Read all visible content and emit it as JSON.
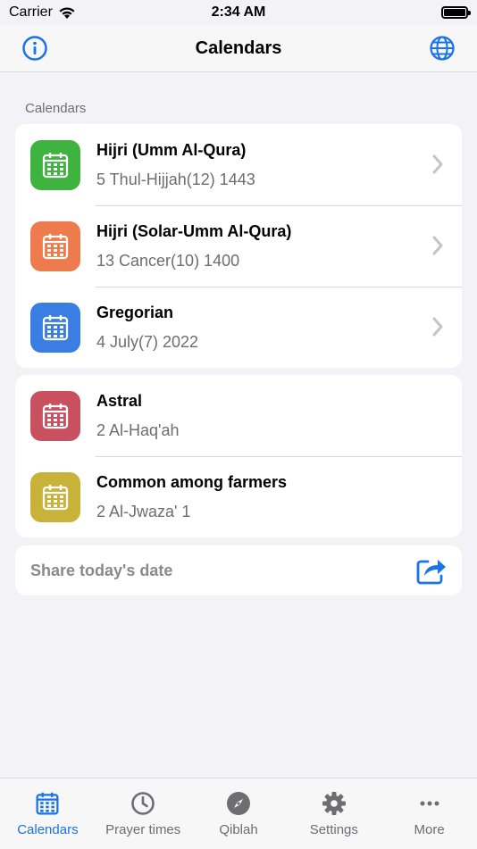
{
  "status": {
    "carrier": "Carrier",
    "time": "2:34 AM"
  },
  "nav": {
    "title": "Calendars",
    "left_icon": "info-icon",
    "right_icon": "globe-icon"
  },
  "section_header": "Calendars",
  "calendars": [
    {
      "title": "Hijri (Umm Al-Qura)",
      "date": "5 Thul-Hijjah(12) 1443",
      "color": "#3eb33f"
    },
    {
      "title": "Hijri (Solar-Umm Al-Qura)",
      "date": "13 Cancer(10) 1400",
      "color": "#ee7b4e"
    },
    {
      "title": "Gregorian",
      "date": "4 July(7) 2022",
      "color": "#3a7ee4"
    }
  ],
  "other_calendars": [
    {
      "title": "Astral",
      "date": "2 Al-Haq'ah",
      "color": "#c9515f"
    },
    {
      "title": "Common among farmers",
      "date": "2 Al-Jwaza' 1",
      "color": "#c9b23a"
    }
  ],
  "share": {
    "label": "Share today's date"
  },
  "tabs": [
    {
      "label": "Calendars",
      "icon": "calendar-icon",
      "active": true
    },
    {
      "label": "Prayer times",
      "icon": "clock-icon",
      "active": false
    },
    {
      "label": "Qiblah",
      "icon": "compass-icon",
      "active": false
    },
    {
      "label": "Settings",
      "icon": "gear-icon",
      "active": false
    },
    {
      "label": "More",
      "icon": "more-icon",
      "active": false
    }
  ],
  "colors": {
    "accent": "#1a73e8",
    "chevron": "#c4c4c8"
  }
}
